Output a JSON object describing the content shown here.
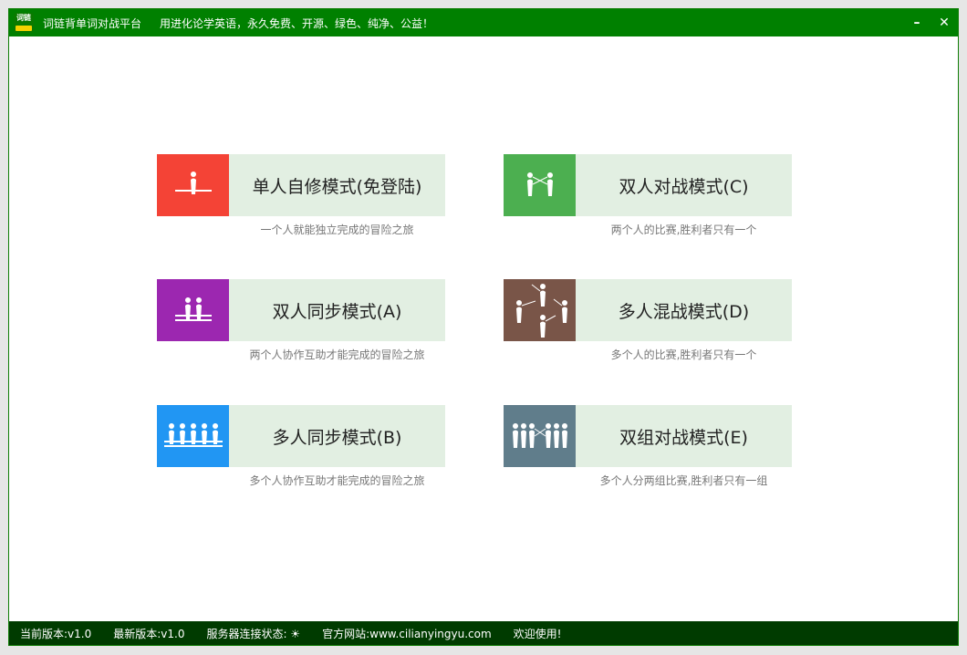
{
  "titlebar": {
    "logo_text": "词链",
    "title": "词链背单词对战平台",
    "slogan": "用进化论学英语，永久免费、开源、绿色、纯净、公益！",
    "minimize_label": "–",
    "close_label": "✕"
  },
  "modes": [
    {
      "label": "单人自修模式(免登陆)",
      "desc": "一个人就能独立完成的冒险之旅",
      "color": "#f44336",
      "icon": "single-person-icon"
    },
    {
      "label": "双人对战模式(C)",
      "desc": "两个人的比赛,胜利者只有一个",
      "color": "#4caf50",
      "icon": "two-person-battle-icon"
    },
    {
      "label": "双人同步模式(A)",
      "desc": "两个人协作互助才能完成的冒险之旅",
      "color": "#9c27b0",
      "icon": "two-person-sync-icon"
    },
    {
      "label": "多人混战模式(D)",
      "desc": "多个人的比赛,胜利者只有一个",
      "color": "#795548",
      "icon": "multi-person-melee-icon"
    },
    {
      "label": "多人同步模式(B)",
      "desc": "多个人协作互助才能完成的冒险之旅",
      "color": "#2196f3",
      "icon": "multi-person-sync-icon"
    },
    {
      "label": "双组对战模式(E)",
      "desc": "多个人分两组比赛,胜利者只有一组",
      "color": "#607d8b",
      "icon": "team-battle-icon"
    }
  ],
  "statusbar": {
    "current_version": "当前版本:v1.0",
    "latest_version": "最新版本:v1.0",
    "server_status": "服务器连接状态: ☀",
    "website": "官方网站:www.cilianyingyu.com",
    "welcome": "欢迎使用!"
  }
}
